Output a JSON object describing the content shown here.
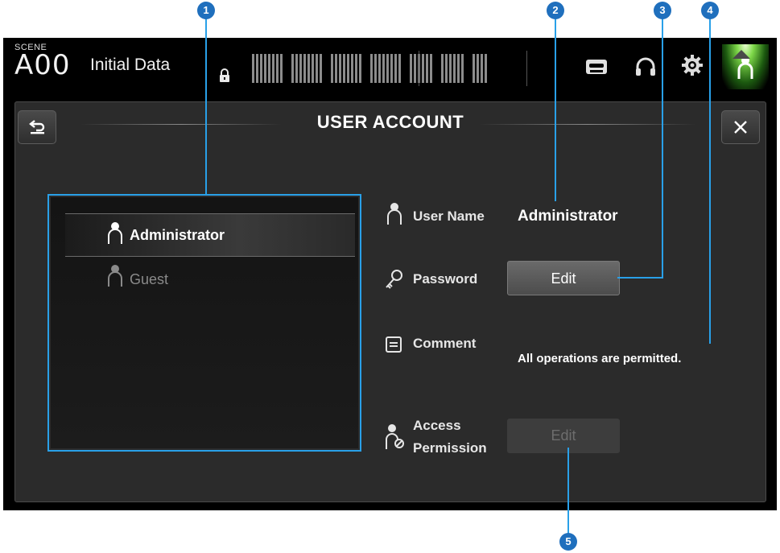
{
  "topbar": {
    "scene_label": "SCENE",
    "scene_number": "A00",
    "scene_title": "Initial Data",
    "icons": [
      "lock-icon",
      "recorder-icon",
      "headphones-icon",
      "gear-icon",
      "user-icon"
    ]
  },
  "dialog": {
    "title": "USER ACCOUNT",
    "back_icon": "return-arrow-icon",
    "close_icon": "close-icon"
  },
  "user_list": {
    "items": [
      {
        "label": "Administrator",
        "selected": true
      },
      {
        "label": "Guest",
        "selected": false
      }
    ]
  },
  "fields": {
    "user_name_label": "User Name",
    "user_name_value": "Administrator",
    "password_label": "Password",
    "password_button": "Edit",
    "comment_label": "Comment",
    "comment_value": "All operations are permitted.",
    "access_label_line1": "Access",
    "access_label_line2": "Permission",
    "access_button": "Edit"
  },
  "callouts": [
    "1",
    "2",
    "3",
    "4",
    "5"
  ],
  "colors": {
    "accent_blue": "#29a0e8",
    "callout_blue": "#1f6fbd",
    "active_tab_green": "#7fd94a",
    "panel_bg": "#2b2b2b"
  }
}
